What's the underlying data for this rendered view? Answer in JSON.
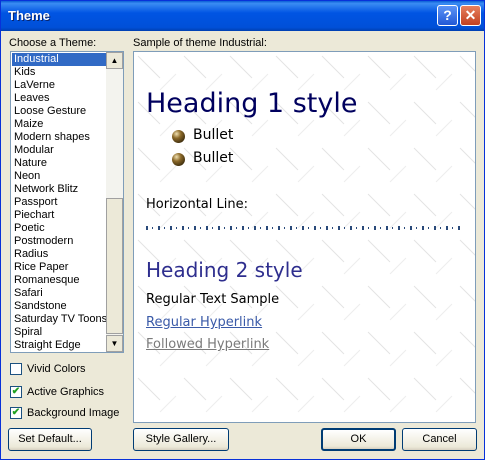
{
  "window": {
    "title": "Theme"
  },
  "titlebar_buttons": {
    "help": "?",
    "close": "✕"
  },
  "themes_label": "Choose a Theme:",
  "themes": [
    "Industrial",
    "Kids",
    "LaVerne",
    "Leaves",
    "Loose Gesture",
    "Maize",
    "Modern shapes",
    "Modular",
    "Nature",
    "Neon",
    "Network Blitz",
    "Passport",
    "Piechart",
    "Poetic",
    "Postmodern",
    "Radius",
    "Rice Paper",
    "Romanesque",
    "Safari",
    "Sandstone",
    "Saturday TV Toons",
    "Spiral",
    "Straight Edge"
  ],
  "selected_theme": "Industrial",
  "sample_label": "Sample of theme Industrial:",
  "sample": {
    "heading1": "Heading 1 style",
    "bullets": [
      "Bullet",
      "Bullet"
    ],
    "hr_label": "Horizontal Line:",
    "heading2": "Heading 2 style",
    "regular_text": "Regular Text Sample",
    "regular_link": "Regular Hyperlink",
    "followed_link": "Followed Hyperlink"
  },
  "options": [
    {
      "label": "Vivid Colors",
      "checked": false
    },
    {
      "label": "Active Graphics",
      "checked": true
    },
    {
      "label": "Background Image",
      "checked": true
    }
  ],
  "check_mark": "✔",
  "scroll": {
    "up": "▲",
    "down": "▼"
  },
  "buttons": {
    "set_default": "Set Default...",
    "style_gallery": "Style Gallery...",
    "ok": "OK",
    "cancel": "Cancel"
  },
  "colors": {
    "titlebar": "#0054e3",
    "selection": "#316ac5",
    "heading1": "#00005e",
    "heading2": "#2e2e8e"
  }
}
